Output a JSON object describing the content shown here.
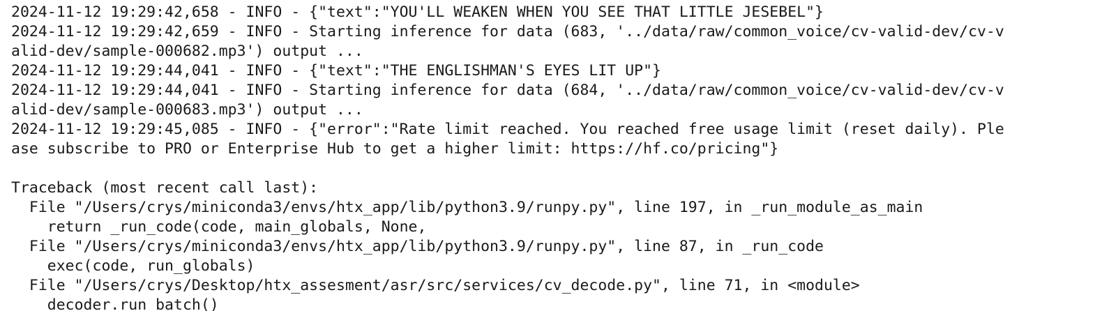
{
  "terminal": {
    "lines": [
      "2024-11-12 19:29:42,658 - INFO - {\"text\":\"YOU'LL WEAKEN WHEN YOU SEE THAT LITTLE JESEBEL\"}",
      "2024-11-12 19:29:42,659 - INFO - Starting inference for data (683, '../data/raw/common_voice/cv-valid-dev/cv-v",
      "alid-dev/sample-000682.mp3') output ...",
      "2024-11-12 19:29:44,041 - INFO - {\"text\":\"THE ENGLISHMAN'S EYES LIT UP\"}",
      "2024-11-12 19:29:44,041 - INFO - Starting inference for data (684, '../data/raw/common_voice/cv-valid-dev/cv-v",
      "alid-dev/sample-000683.mp3') output ...",
      "2024-11-12 19:29:45,085 - INFO - {\"error\":\"Rate limit reached. You reached free usage limit (reset daily). Ple",
      "ase subscribe to PRO or Enterprise Hub to get a higher limit: https://hf.co/pricing\"}",
      "",
      "Traceback (most recent call last):",
      "  File \"/Users/crys/miniconda3/envs/htx_app/lib/python3.9/runpy.py\", line 197, in _run_module_as_main",
      "    return _run_code(code, main_globals, None,",
      "  File \"/Users/crys/miniconda3/envs/htx_app/lib/python3.9/runpy.py\", line 87, in _run_code",
      "    exec(code, run_globals)",
      "  File \"/Users/crys/Desktop/htx_assesment/asr/src/services/cv_decode.py\", line 71, in <module>",
      "    decoder.run_batch()"
    ]
  }
}
